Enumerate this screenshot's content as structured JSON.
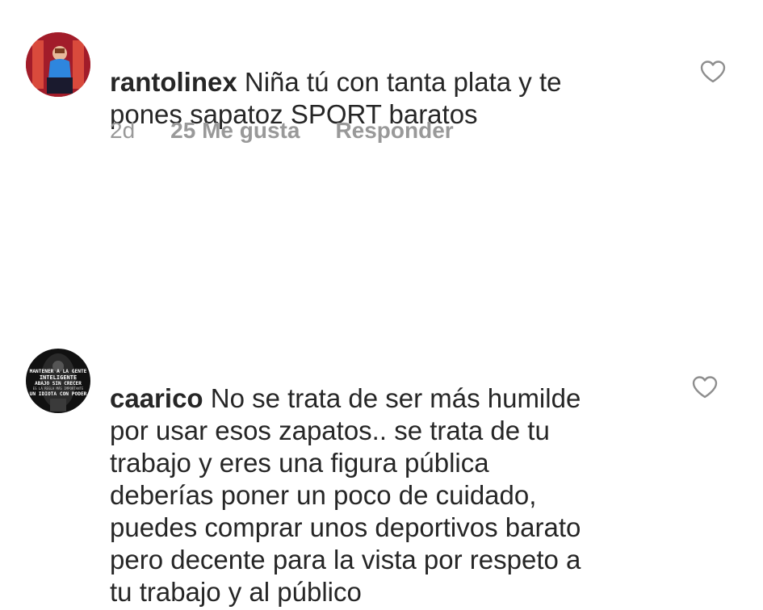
{
  "comments": [
    {
      "username": "rantolinex",
      "text": "Niña tú con tanta plata y te\npones sapatoz SPORT baratos",
      "time": "2d",
      "likes": "25 Me gusta",
      "reply": "Responder",
      "avatar_icon": "profile-photo"
    },
    {
      "username": "caarico",
      "text": "No se trata de ser más humilde\npor usar esos zapatos.. se trata de tu\ntrabajo y eres una figura pública\ndeberías poner un poco de cuidado,\npuedes comprar unos deportivos barato\npero decente para la vista por respeto a\ntu trabajo y al público",
      "avatar_icon": "profile-photo",
      "avatar_text": "MANTENER A LA GENTE INTELIGENTE ABAJO SIN CRECER ES LA REGLA MÁS IMPORTANTE DE UN IDIOTA CON PODER"
    }
  ],
  "colors": {
    "text": "#262626",
    "meta": "#999999",
    "heart_outline": "#8e8e8e"
  }
}
